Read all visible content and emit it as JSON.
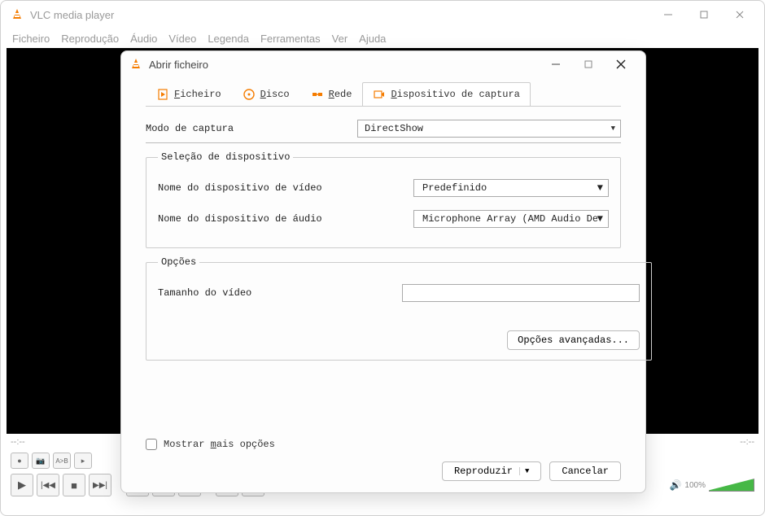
{
  "main": {
    "title": "VLC media player",
    "menu": [
      "Ficheiro",
      "Reprodução",
      "Áudio",
      "Vídeo",
      "Legenda",
      "Ferramentas",
      "Ver",
      "Ajuda"
    ],
    "time_left": "--:--",
    "time_right": "--:--",
    "volume": "100%"
  },
  "dialog": {
    "title": "Abrir ficheiro",
    "tabs": {
      "file": "Ficheiro",
      "disc": "Disco",
      "network": "Rede",
      "capture": "Dispositivo de captura"
    },
    "capture_mode_label": "Modo de captura",
    "capture_mode_value": "DirectShow",
    "device_group": "Seleção de dispositivo",
    "video_dev_label": "Nome do dispositivo de vídeo",
    "video_dev_value": "Predefinido",
    "audio_dev_label": "Nome do dispositivo de áudio",
    "audio_dev_value": "Microphone Array (AMD Audio Device)",
    "options_group": "Opções",
    "video_size_label": "Tamanho do vídeo",
    "advanced_btn": "Opções avançadas...",
    "show_more": "Mostrar mais opções",
    "play_btn": "Reproduzir",
    "cancel_btn": "Cancelar"
  }
}
